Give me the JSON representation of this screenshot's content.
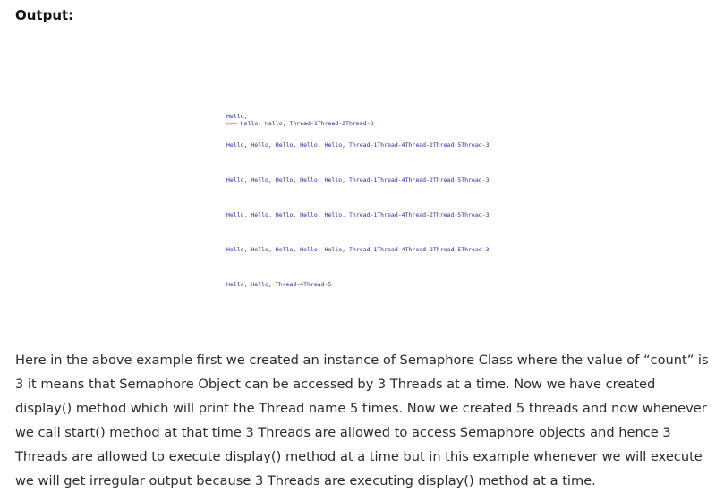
{
  "heading": "Output:",
  "shell": {
    "first_line": "Hello,",
    "prompt": ">>>",
    "lines": [
      " Hello, Hello, Thread-1Thread-2Thread-3",
      "Hello, Hello, Hello, Hello, Hello, Thread-1Thread-4Thread-2Thread-5Thread-3",
      "Hello, Hello, Hello, Hello, Hello, Thread-1Thread-4Thread-2Thread-5Thread-3",
      "Hello, Hello, Hello, Hello, Hello, Thread-1Thread-4Thread-2Thread-5Thread-3",
      "Hello, Hello, Hello, Hello, Hello, Thread-1Thread-4Thread-2Thread-5Thread-3",
      "Hello, Hello, Thread-4Thread-5"
    ]
  },
  "paragraph": "Here in the above example first we created an instance of Semaphore Class where the value of “count” is 3 it means that Semaphore Object can be accessed by 3 Threads at a time. Now we have created display() method which will print the Thread name 5 times. Now we created 5 threads and now whenever we call start() method at that time 3 Threads are allowed to access Semaphore objects and hence 3 Threads are allowed to execute display() method at a time but in this example whenever we will execute we will get irregular output because 3 Threads are executing display() method at a time."
}
